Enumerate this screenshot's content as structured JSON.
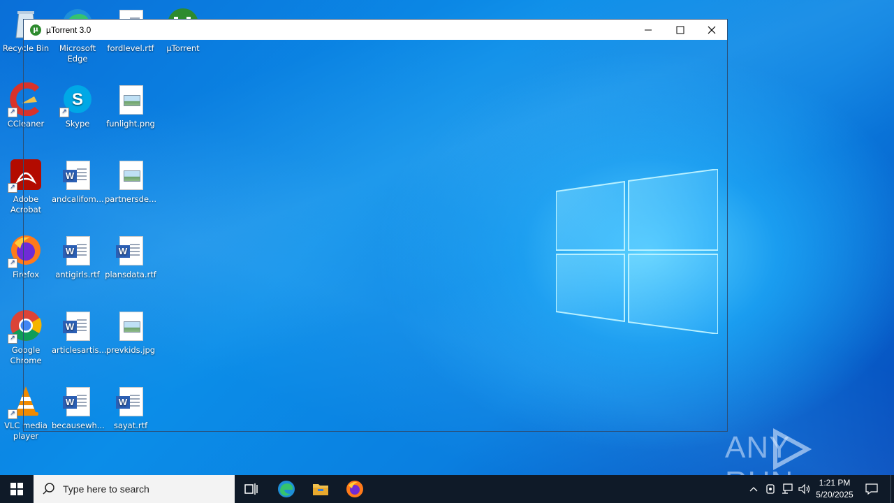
{
  "window": {
    "title": "µTorrent 3.0"
  },
  "desktop": {
    "icons": [
      {
        "label": "Recycle Bin"
      },
      {
        "label": "Microsoft Edge"
      },
      {
        "label": "fordlevel.rtf"
      },
      {
        "label": "µTorrent"
      },
      {
        "label": "CCleaner"
      },
      {
        "label": "Skype"
      },
      {
        "label": "funlight.png"
      },
      {
        "label": "Adobe Acrobat"
      },
      {
        "label": "andcalifom..."
      },
      {
        "label": "partnersde..."
      },
      {
        "label": "Firefox"
      },
      {
        "label": "antigirls.rtf"
      },
      {
        "label": "plansdata.rtf"
      },
      {
        "label": "Google Chrome"
      },
      {
        "label": "articlesartis..."
      },
      {
        "label": "prevkids.jpg"
      },
      {
        "label": "VLC media player"
      },
      {
        "label": "becausewh..."
      },
      {
        "label": "sayat.rtf"
      }
    ]
  },
  "watermark": "ANY RUN",
  "taskbar": {
    "search_placeholder": "Type here to search",
    "time": "1:21 PM",
    "date": "5/20/2025"
  },
  "colors": {
    "taskbar_bg": "#0f1a28",
    "desktop_accent": "#0b8de8"
  }
}
